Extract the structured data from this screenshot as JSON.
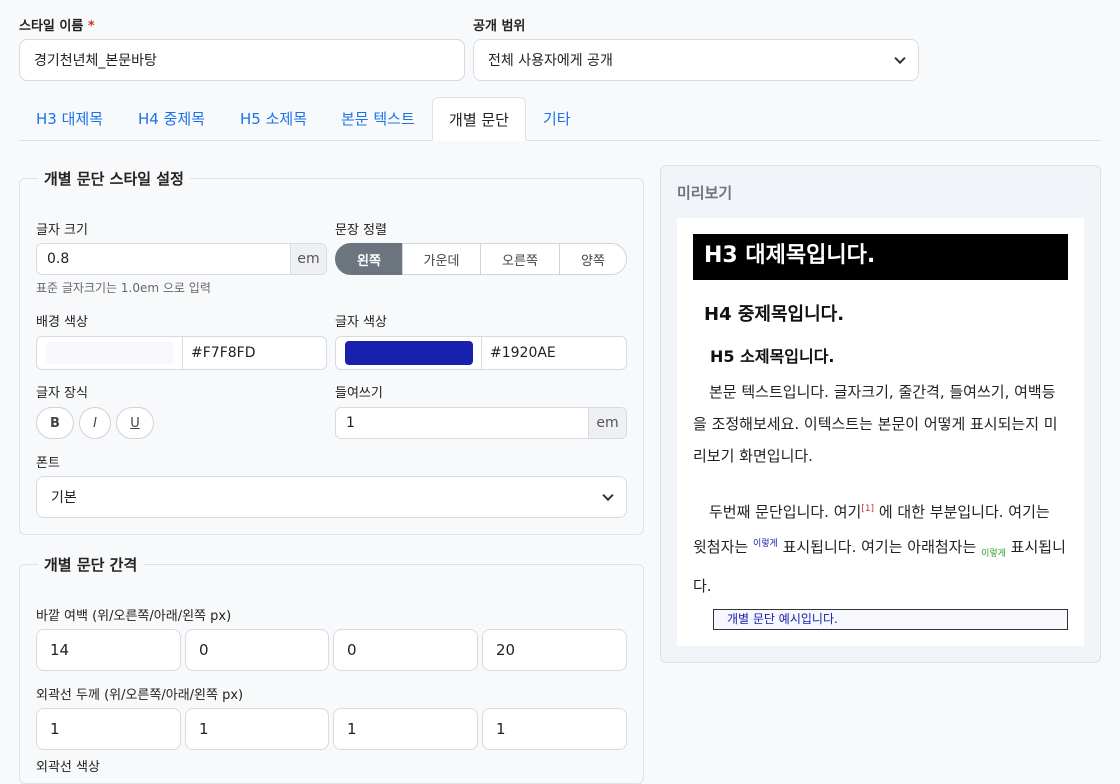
{
  "form": {
    "style_name_label": "스타일 이름",
    "required_mark": "*",
    "style_name_value": "경기천년체_본문바탕",
    "visibility_label": "공개 범위",
    "visibility_value": "전체 사용자에게 공개"
  },
  "tabs": [
    {
      "label": "H3 대제목",
      "active": false
    },
    {
      "label": "H4 중제목",
      "active": false
    },
    {
      "label": "H5 소제목",
      "active": false
    },
    {
      "label": "본문 텍스트",
      "active": false
    },
    {
      "label": "개별 문단",
      "active": true
    },
    {
      "label": "기타",
      "active": false
    }
  ],
  "style_section": {
    "legend": "개별 문단 스타일 설정",
    "font_size_label": "글자 크기",
    "font_size_value": "0.8",
    "font_size_unit": "em",
    "font_size_hint": "표준 글자크기는 1.0em 으로 입력",
    "align_label": "문장 정렬",
    "align_options": [
      "왼쪽",
      "가운데",
      "오른쪽",
      "양쪽"
    ],
    "align_selected": "왼쪽",
    "bg_color_label": "배경 색상",
    "bg_color_value": "#F7F8FD",
    "text_color_label": "글자 색상",
    "text_color_value": "#1920AE",
    "decoration_label": "글자 장식",
    "decorations": [
      "B",
      "I",
      "U"
    ],
    "indent_label": "들여쓰기",
    "indent_value": "1",
    "indent_unit": "em",
    "font_label": "폰트",
    "font_value": "기본"
  },
  "spacing_section": {
    "legend": "개별 문단 간격",
    "margin_label": "바깥 여백 (위/오른쪽/아래/왼쪽 px)",
    "margin_values": [
      "14",
      "0",
      "0",
      "20"
    ],
    "border_label": "외곽선 두께 (위/오른쪽/아래/왼쪽 px)",
    "border_values": [
      "1",
      "1",
      "1",
      "1"
    ],
    "border_color_label": "외곽선 색상"
  },
  "preview": {
    "title": "미리보기",
    "h3": "H3 대제목입니다.",
    "h4": "H4 중제목입니다.",
    "h5": "H5 소제목입니다.",
    "body1": "본문 텍스트입니다. 글자크기, 줄간격, 들여쓰기, 여백등을 조정해보세요. 이텍스트는 본문이 어떻게 표시되는지 미리보기 화면입니다.",
    "body2_a": "두번째 문단입니다. 여기",
    "footnote": "[1]",
    "body2_b": " 에 대한 부분입니다. 여기는 윗첨자는 ",
    "superscript": "이렇게",
    "body2_c": " 표시됩니다. 여기는 아래첨자는 ",
    "subscript": "이렇게",
    "body2_d": " 표시됩니다.",
    "paragraph_example": "개별 문단 예시입니다."
  },
  "colors": {
    "accent": "#1a73e8",
    "bg_swatch": "#F7F8FD",
    "text_swatch": "#1920AE"
  }
}
